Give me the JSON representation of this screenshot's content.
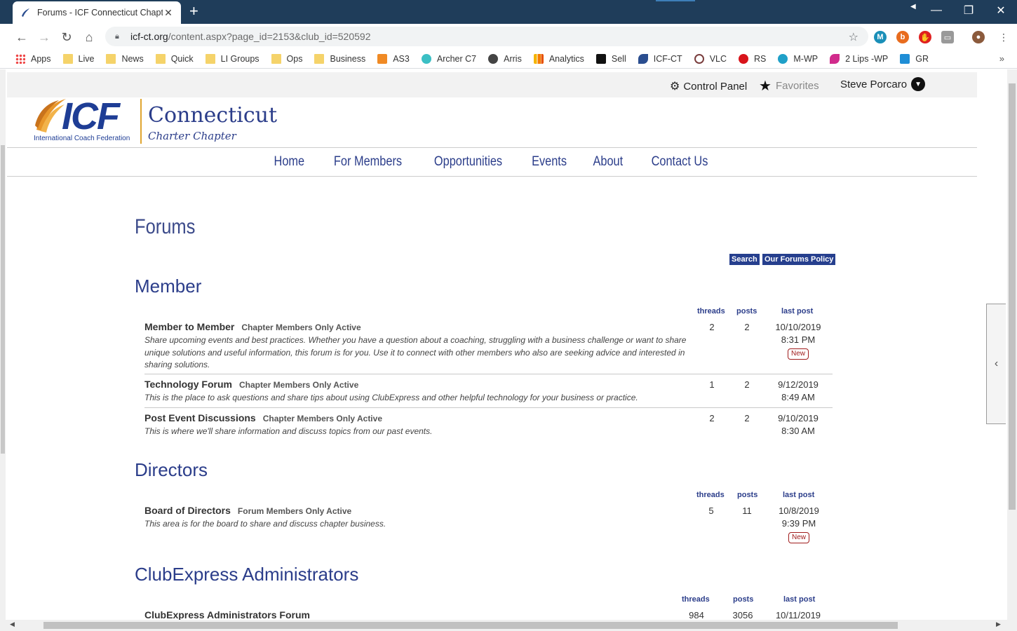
{
  "browser": {
    "tab_title": "Forums - ICF Connecticut Chapte",
    "url_host": "icf-ct.org",
    "url_path": "/content.aspx?page_id=2153&club_id=520592",
    "bookmarks": [
      {
        "label": "Apps",
        "icon": "apps-grid-icon"
      },
      {
        "label": "Live",
        "icon": "folder-icon"
      },
      {
        "label": "News",
        "icon": "folder-icon"
      },
      {
        "label": "Quick",
        "icon": "folder-icon"
      },
      {
        "label": "LI Groups",
        "icon": "folder-icon"
      },
      {
        "label": "Ops",
        "icon": "folder-icon"
      },
      {
        "label": "Business",
        "icon": "folder-icon"
      },
      {
        "label": "AS3",
        "icon": "aws-icon"
      },
      {
        "label": "Archer C7",
        "icon": "tplink-icon"
      },
      {
        "label": "Arris",
        "icon": "globe-icon"
      },
      {
        "label": "Analytics",
        "icon": "analytics-icon"
      },
      {
        "label": "Sell",
        "icon": "amazon-icon"
      },
      {
        "label": "ICF-CT",
        "icon": "icf-icon"
      },
      {
        "label": "VLC",
        "icon": "vlc-icon"
      },
      {
        "label": "RS",
        "icon": "rs-icon"
      },
      {
        "label": "M-WP",
        "icon": "m-wp-icon"
      },
      {
        "label": "2 Lips -WP",
        "icon": "lips-icon"
      },
      {
        "label": "GR",
        "icon": "mail-icon"
      }
    ]
  },
  "topbar": {
    "control_panel": "Control Panel",
    "favorites": "Favorites",
    "user": "Steve Porcaro"
  },
  "brand": {
    "icf": "ICF",
    "icf_sub": "International Coach Federation",
    "chapter": "Connecticut",
    "chapter_sub": "Charter Chapter",
    "colors": {
      "navy": "#1e3d95",
      "gold": "#e0a530"
    }
  },
  "nav": [
    "Home",
    "For Members",
    "Opportunities",
    "Events",
    "About",
    "Contact Us"
  ],
  "page": {
    "title": "Forums",
    "search_button": "Search",
    "policy_button": "Our Forums Policy"
  },
  "columns": {
    "threads": "threads",
    "posts": "posts",
    "last_post": "last post"
  },
  "sections": [
    {
      "title": "Member",
      "forums": [
        {
          "name": "Member to Member",
          "meta": "Chapter Members Only  Active",
          "desc": "Share upcoming events and best practices. Whether you have a question about a coaching, struggling with a business challenge or want to share unique solutions and useful information, this forum is for you. Use it to connect with other members who also are seeking advice and interested in sharing solutions.",
          "threads": "2",
          "posts": "2",
          "date": "10/10/2019",
          "time": "8:31 PM",
          "badge": "New"
        },
        {
          "name": "Technology Forum",
          "meta": "Chapter Members Only  Active",
          "desc": "This is the place to ask questions and share tips about using ClubExpress and other helpful technology for your business or practice.",
          "threads": "1",
          "posts": "2",
          "date": "9/12/2019",
          "time": "8:49 AM"
        },
        {
          "name": "Post Event Discussions",
          "meta": "Chapter Members Only  Active",
          "desc": "This is where we'll share information and discuss topics from our past events.",
          "threads": "2",
          "posts": "2",
          "date": "9/10/2019",
          "time": "8:30 AM"
        }
      ]
    },
    {
      "title": "Directors",
      "forums": [
        {
          "name": "Board of Directors",
          "meta": "Forum Members Only  Active",
          "desc": "This area is for the board to share and discuss chapter business.",
          "threads": "5",
          "posts": "11",
          "date": "10/8/2019",
          "time": "9:39 PM",
          "badge": "New"
        }
      ]
    },
    {
      "title": "ClubExpress Administrators",
      "forums": [
        {
          "name": "ClubExpress Administrators Forum",
          "threads": "984",
          "posts": "3056",
          "date": "10/11/2019"
        }
      ]
    }
  ]
}
